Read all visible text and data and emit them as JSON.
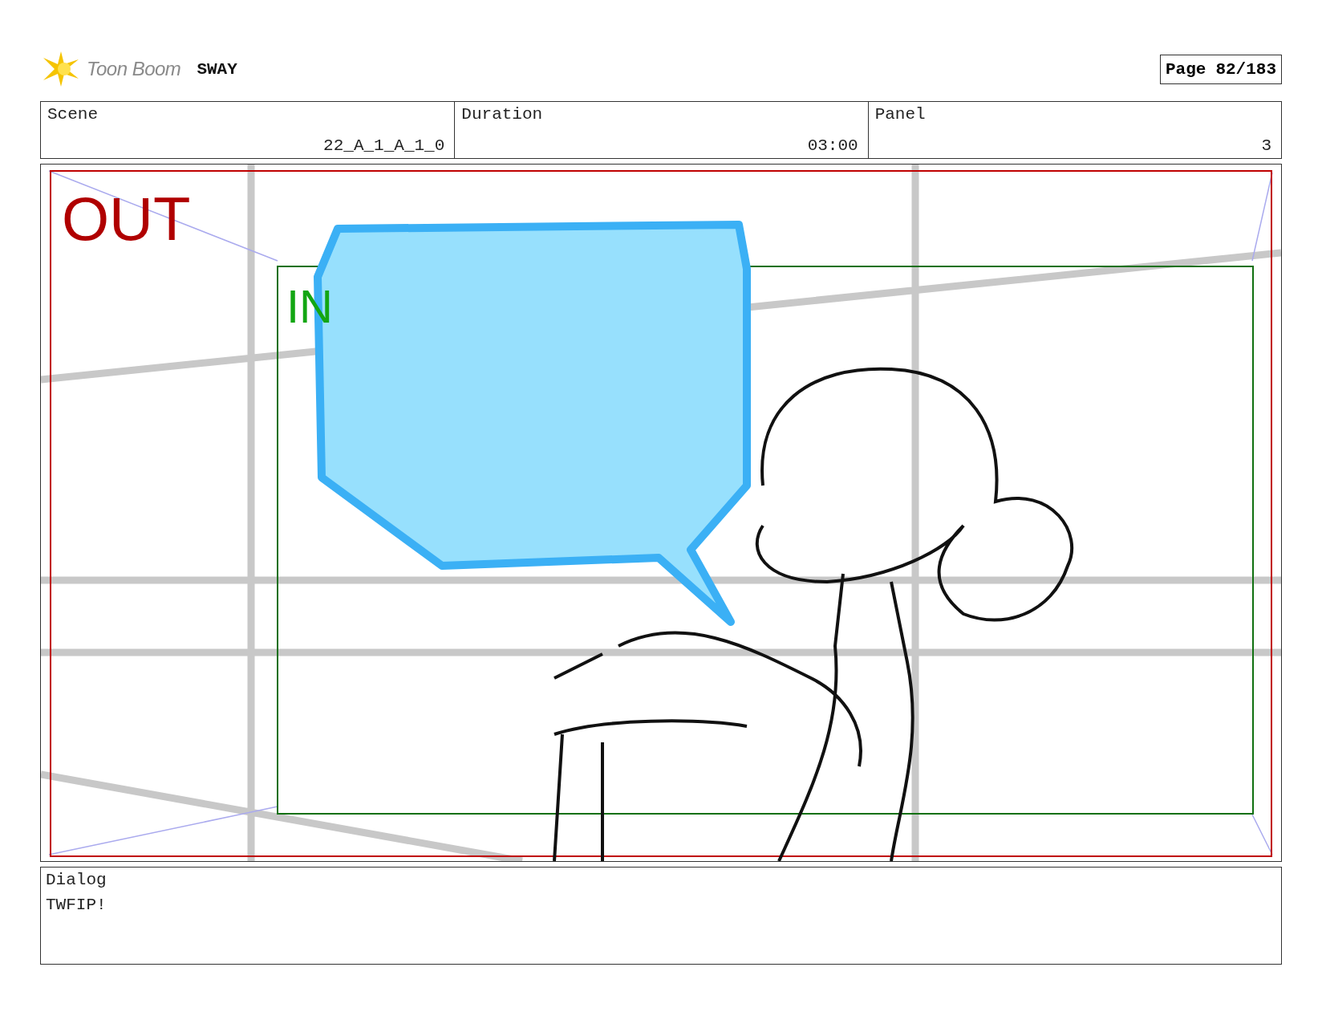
{
  "header": {
    "brand": "Toon Boom",
    "project": "SWAY",
    "page_label": "Page",
    "page_number": "82/183"
  },
  "info": [
    {
      "label": "Scene",
      "value": "22_A_1_A_1_0"
    },
    {
      "label": "Duration",
      "value": "03:00"
    },
    {
      "label": "Panel",
      "value": "3"
    }
  ],
  "panel": {
    "out_label": "OUT",
    "in_label": "IN"
  },
  "dialog": {
    "label": "Dialog",
    "text": "TWFIP!"
  }
}
